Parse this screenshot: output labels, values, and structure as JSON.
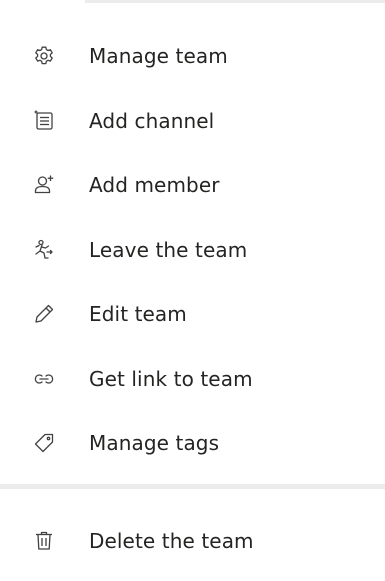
{
  "menu": {
    "items": [
      {
        "label": "Manage team",
        "icon": "gear-icon"
      },
      {
        "label": "Add channel",
        "icon": "channel-list-icon"
      },
      {
        "label": "Add member",
        "icon": "add-person-icon"
      },
      {
        "label": "Leave the team",
        "icon": "leave-runner-icon"
      },
      {
        "label": "Edit team",
        "icon": "pencil-icon"
      },
      {
        "label": "Get link to team",
        "icon": "link-icon"
      },
      {
        "label": "Manage tags",
        "icon": "tag-icon"
      }
    ],
    "delete": {
      "label": "Delete the team",
      "icon": "trash-icon"
    }
  }
}
